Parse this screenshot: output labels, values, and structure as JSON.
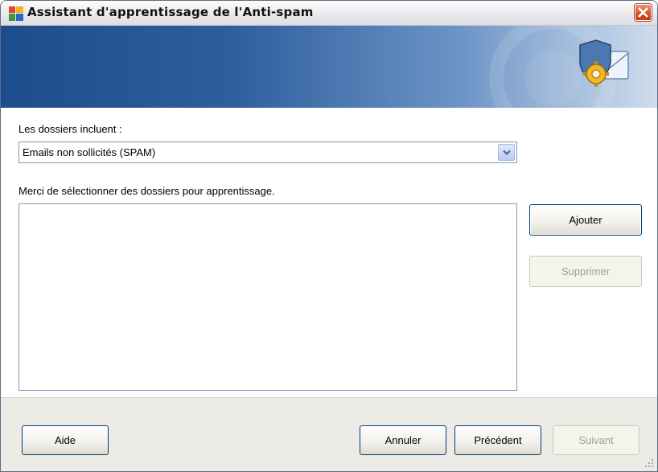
{
  "window": {
    "title": "Assistant d'apprentissage de l'Anti-spam",
    "title_icon": "avg-logo-icon",
    "close_icon": "close-icon"
  },
  "banner": {
    "icon": "mail-shield-gear-icon"
  },
  "form": {
    "folders_label": "Les dossiers incluent :",
    "folders_select": {
      "value": "Emails non sollicités (SPAM)",
      "icon": "chevron-down-icon"
    },
    "select_prompt": "Merci de sélectionner des dossiers pour apprentissage.",
    "folders_list": []
  },
  "side_buttons": {
    "add": "Ajouter",
    "remove": "Supprimer"
  },
  "footer": {
    "help": "Aide",
    "cancel": "Annuler",
    "previous": "Précédent",
    "next": "Suivant"
  },
  "colors": {
    "banner_start": "#1d4d8d",
    "banner_end": "#cfdded",
    "close_button": "#d5522a",
    "button_border": "#003c74",
    "disabled_text": "#a19f91"
  }
}
